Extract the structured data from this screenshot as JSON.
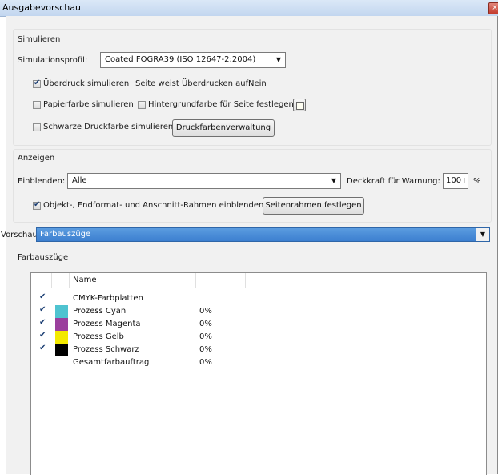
{
  "window": {
    "title": "Ausgabevorschau",
    "close_glyph": "×"
  },
  "simulate": {
    "group_label": "Simulieren",
    "profile_label": "Simulationsprofil:",
    "profile_value": "Coated FOGRA39 (ISO 12647-2:2004)",
    "overprint_label": "Überdruck simulieren",
    "overprint_checked": true,
    "page_overprint_label": "Seite weist Überdrucken auf:",
    "page_overprint_value": "Nein",
    "paper_color_label": "Papierfarbe simulieren",
    "paper_color_checked": false,
    "bg_color_label": "Hintergrundfarbe für Seite festlegen",
    "bg_color_checked": false,
    "black_ink_label": "Schwarze Druckfarbe simulieren",
    "black_ink_checked": false,
    "ink_manager_button": "Druckfarbenverwaltung"
  },
  "display": {
    "group_label": "Anzeigen",
    "show_label": "Einblenden:",
    "show_value": "Alle",
    "opacity_label": "Deckkraft für Warnung:",
    "opacity_value": "100",
    "opacity_unit": "%",
    "boxes_label": "Objekt-, Endformat- und Anschnitt-Rahmen einblenden",
    "boxes_checked": true,
    "page_boxes_button": "Seitenrahmen festlegen"
  },
  "preview": {
    "label": "Vorschau:",
    "value": "Farbauszüge"
  },
  "separations": {
    "group_label": "Farbauszüge",
    "column_name": "Name",
    "rows": [
      {
        "name": "CMYK-Farbplatten",
        "percent": "",
        "checked": true,
        "color": ""
      },
      {
        "name": "Prozess Cyan",
        "percent": "0%",
        "checked": true,
        "color": "#4fc3d0"
      },
      {
        "name": "Prozess Magenta",
        "percent": "0%",
        "checked": true,
        "color": "#9b3f9d"
      },
      {
        "name": "Prozess Gelb",
        "percent": "0%",
        "checked": true,
        "color": "#f3e900"
      },
      {
        "name": "Prozess Schwarz",
        "percent": "0%",
        "checked": true,
        "color": "#000000"
      },
      {
        "name": "Gesamtfarbauftrag",
        "percent": "0%",
        "checked": false,
        "color": ""
      }
    ]
  }
}
